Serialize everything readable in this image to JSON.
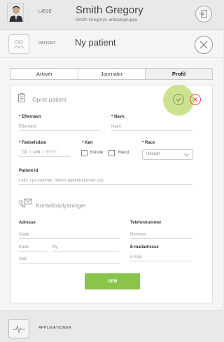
{
  "header": {
    "role": "LÆGE",
    "doctor_name": "Smith Gregory",
    "doctor_group": "Smith Gregorys arbejdsgruppe"
  },
  "patient_bar": {
    "label": "PATIENT",
    "title": "Ny patient"
  },
  "tabs": [
    {
      "label": "Arkivér",
      "active": false
    },
    {
      "label": "Journaler",
      "active": false
    },
    {
      "label": "Profil",
      "active": true
    }
  ],
  "form": {
    "section_title": "Opret patient",
    "efternavn": {
      "label": "* Efternavn",
      "placeholder": "Efternavn"
    },
    "navn": {
      "label": "* Navn",
      "placeholder": "Navn"
    },
    "foedselsdato": {
      "label": "* Fødselsdato",
      "dd": "DD",
      "mm": "MM",
      "yyyy": "YYYY",
      "sep": "/"
    },
    "koen": {
      "label": "* Køn",
      "option1": "Kvinde",
      "option2": "Mand"
    },
    "race": {
      "label": "* Race",
      "value": "Ukendt"
    },
    "patient_id": {
      "label": "Patient-id",
      "placeholder": "f.eks. cpr-nummer, internt patientnummer osv."
    },
    "contact_title": "Kontaktoplysninger",
    "adresse": {
      "label": "Adresse",
      "gade": "Gade",
      "kode": "Kode",
      "by": "By",
      "stat": "Stat"
    },
    "telefon": {
      "label": "Telefonnummer",
      "placeholder": "Nummer"
    },
    "email": {
      "label": "E-mailadresse",
      "placeholder": "e-mail"
    },
    "save_label": "GEM"
  },
  "footer": {
    "label": "APPLIKATIONER"
  },
  "colors": {
    "accent_green": "#8ac449",
    "halo_green": "#cde291",
    "cancel_red": "#e05050"
  }
}
